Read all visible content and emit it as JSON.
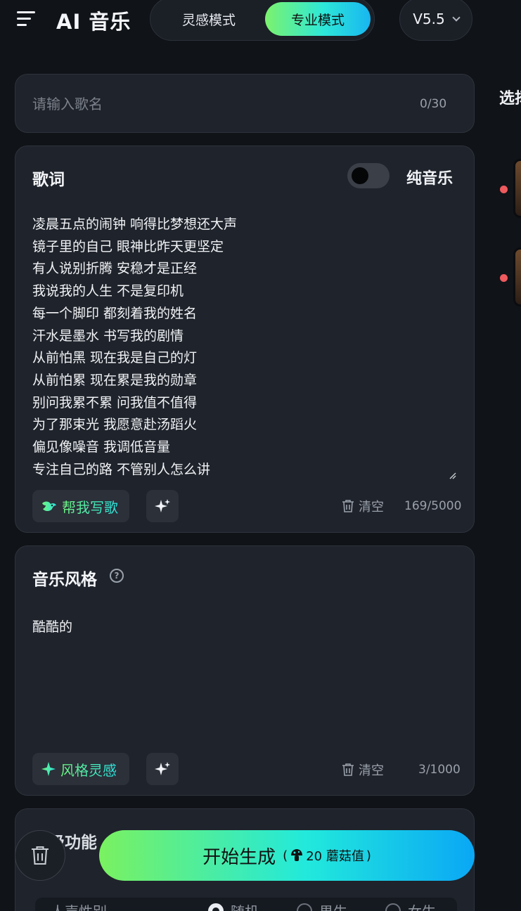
{
  "header": {
    "title": "AI 音乐",
    "modes": [
      "灵感模式",
      "专业模式"
    ],
    "active_mode": "专业模式",
    "version": "V5.5"
  },
  "song_name": {
    "placeholder": "请输入歌名",
    "value": "",
    "counter": "0/30"
  },
  "lyrics": {
    "title": "歌词",
    "pure_music_label": "纯音乐",
    "pure_music_on": false,
    "lines": [
      "凌晨五点的闹钟 响得比梦想还大声",
      "镜子里的自己 眼神比昨天更坚定",
      "有人说别折腾 安稳才是正经",
      "我说我的人生 不是复印机",
      "每一个脚印 都刻着我的姓名",
      "汗水是墨水 书写我的剧情",
      "从前怕黑 现在我是自己的灯",
      "从前怕累 现在累是我的勋章",
      "别问我累不累 问我值不值得",
      "为了那束光 我愿意赴汤蹈火",
      "偏见像噪音 我调低音量",
      "专注自己的路 不管别人怎么讲"
    ],
    "help_write_label": "帮我写歌",
    "clear_label": "清空",
    "counter": "169/5000"
  },
  "style": {
    "title": "音乐风格",
    "value": "酷酷的",
    "inspire_label": "风格灵感",
    "clear_label": "清空",
    "counter": "3/1000"
  },
  "advanced": {
    "title": "高级功能",
    "vocal_gender_label": "人声性别",
    "options": [
      "随机",
      "男生",
      "女生"
    ]
  },
  "side_panel": {
    "title": "选择"
  },
  "generate": {
    "label": "开始生成",
    "cost_prefix": "(",
    "cost": "20 蘑菇值",
    "cost_suffix": ")"
  },
  "colors": {
    "accent_gradient_start": "#7af160",
    "accent_gradient_end": "#0aa7f5",
    "background": "#101318",
    "card": "#1f232b"
  },
  "icons": [
    "menu-icon",
    "chevron-down-icon",
    "bird-icon",
    "sparkle-icon",
    "trash-icon",
    "help-icon",
    "mushroom-icon"
  ]
}
